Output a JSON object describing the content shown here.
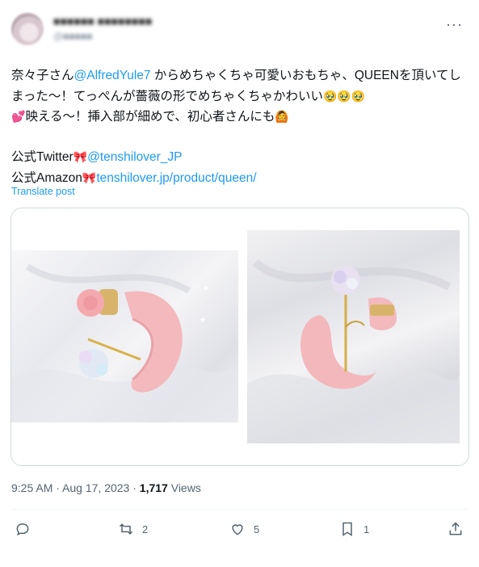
{
  "header": {
    "name": "■■■■■■ ■■■■■■■■",
    "handle": "@■■■■■",
    "more": "···"
  },
  "tweet": {
    "p1": "奈々子さん",
    "mention1": "@AlfredYule7",
    "p2": " からめちゃくちゃ可愛いおもちゃ、QUEENを頂いてしまった〜！てっぺんが薔薇の形でめちゃくちゃかわいい",
    "emoji_pleading": "🥹🥹🥹",
    "emoji_heart": "💕",
    "p3": "映える〜！挿入部が細めで、初心者さんにも",
    "emoji_person": "🙆",
    "twitter_prefix": "公式Twitter",
    "ribbon": "🎀",
    "twitter_link": "@tenshilover_JP",
    "amazon_prefix": "公式Amazon",
    "amazon_link": "tenshilover.jp/product/queen/"
  },
  "translate_label": "Translate post",
  "meta": {
    "time": "9:25 AM",
    "sep": " · ",
    "date": "Aug 17, 2023",
    "views_count": "1,717",
    "views_label": " Views"
  },
  "actions": {
    "reply_count": "",
    "retweet_count": "2",
    "like_count": "5",
    "bookmark_count": "1"
  },
  "colors": {
    "accent": "#1d9bf0",
    "text": "#0f1419",
    "muted": "#536471",
    "border": "#cfd9de"
  }
}
